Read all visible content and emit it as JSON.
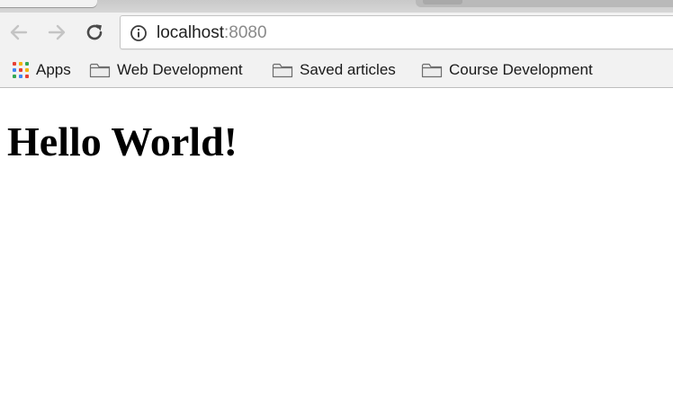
{
  "browser": {
    "address_bar": {
      "host": "localhost",
      "port": ":8080"
    },
    "nav": {
      "back_icon": "arrow-left-icon",
      "forward_icon": "arrow-right-icon",
      "reload_icon": "reload-icon",
      "info_icon": "info-circle-icon"
    },
    "bookmarks": {
      "apps_label": "Apps",
      "items": [
        {
          "label": "Web Development",
          "icon": "folder-icon"
        },
        {
          "label": "Saved articles",
          "icon": "folder-icon"
        },
        {
          "label": "Course Development",
          "icon": "folder-icon"
        }
      ]
    }
  },
  "page": {
    "heading": "Hello World!"
  },
  "colors": {
    "chrome_bg": "#f2f2f2",
    "apps_grid": [
      "#e84135",
      "#f5b400",
      "#34a853",
      "#4285f4",
      "#e84135",
      "#f5b400",
      "#34a853",
      "#4285f4",
      "#e84135"
    ]
  }
}
